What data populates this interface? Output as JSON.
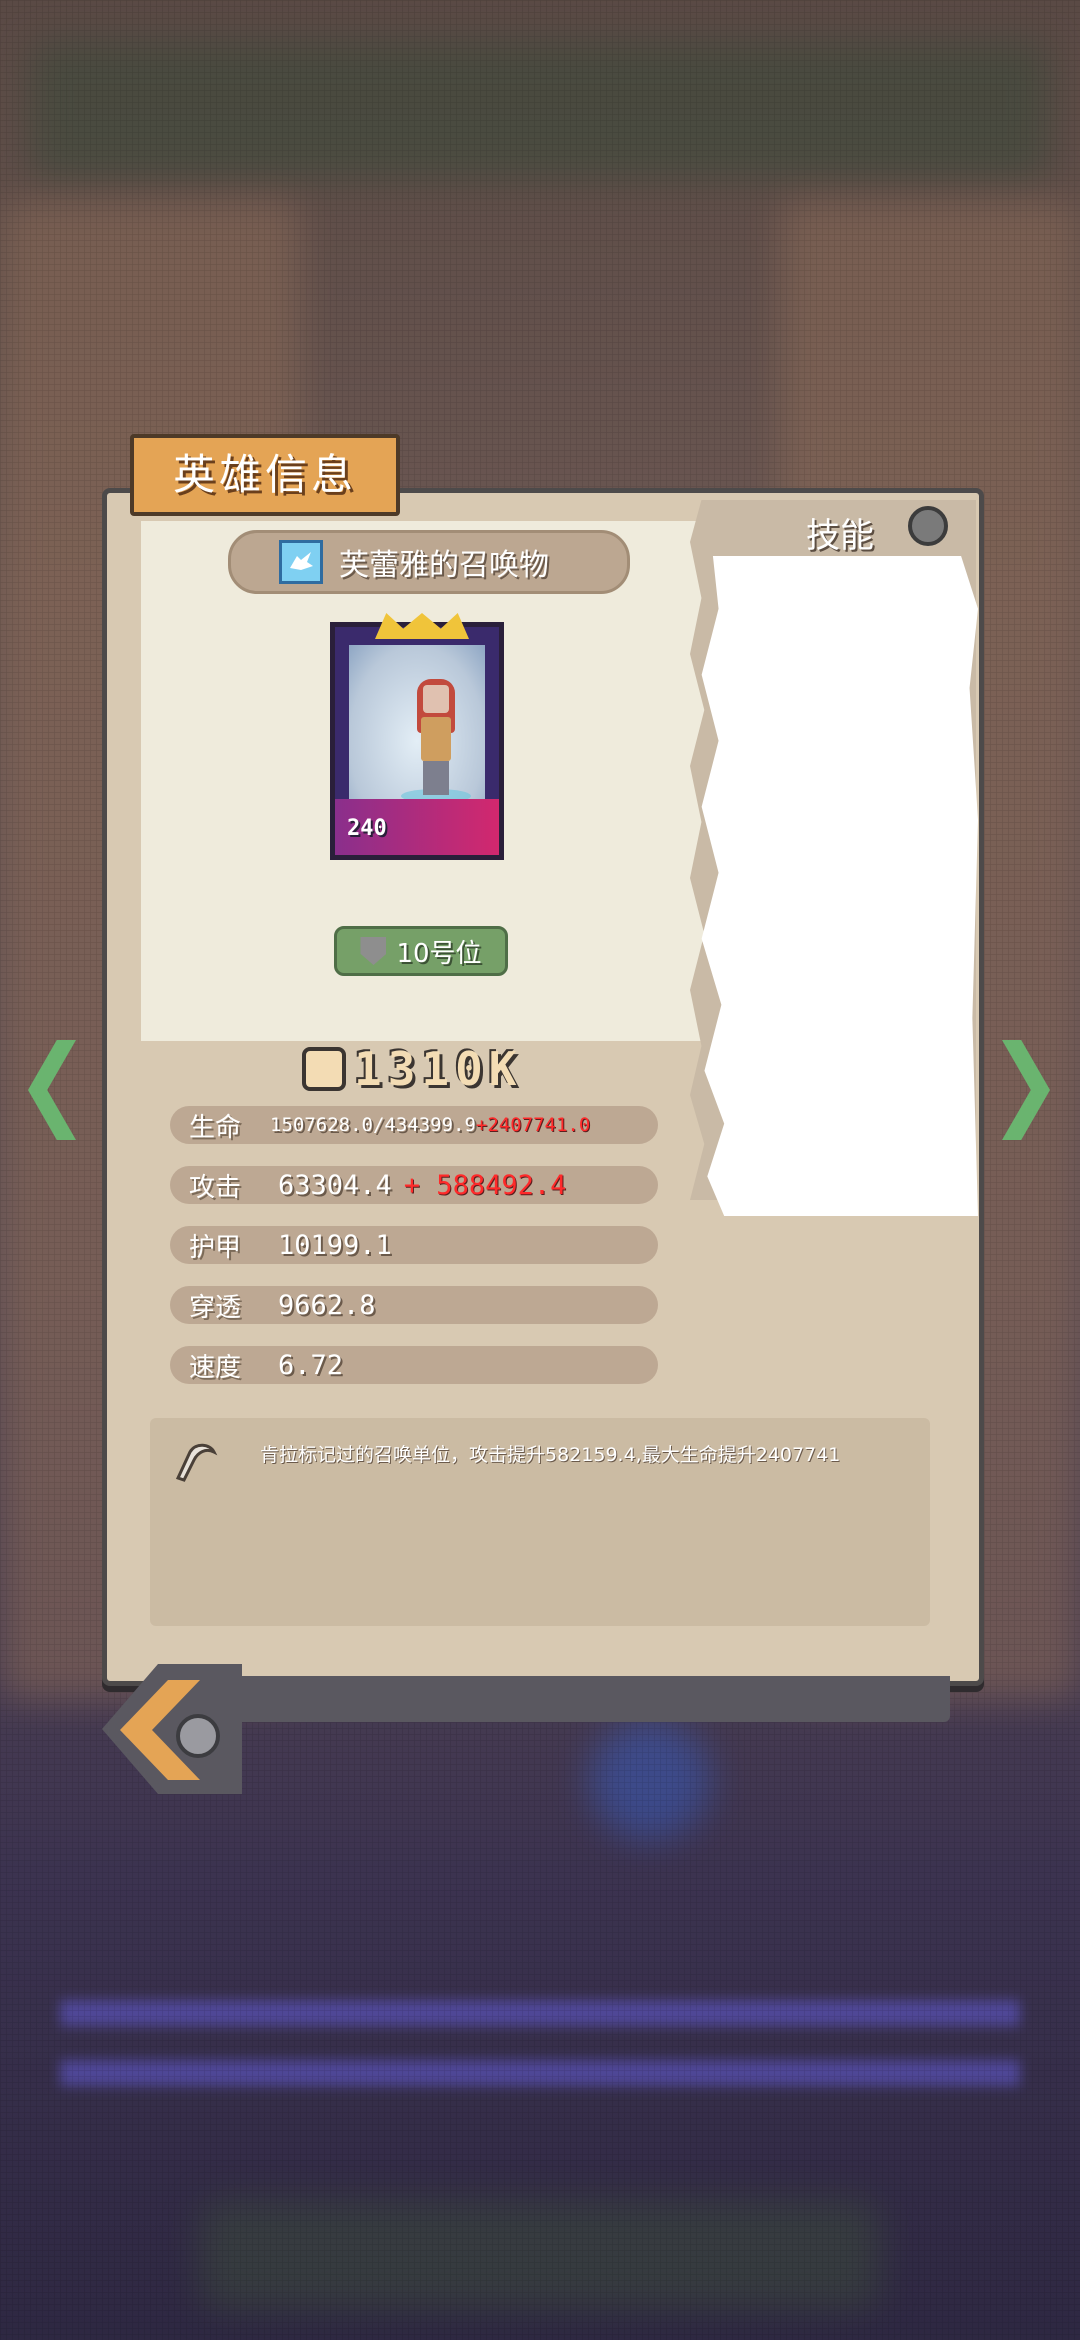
{
  "panel": {
    "title": "英雄信息",
    "skill_tab": "技能"
  },
  "hero": {
    "name": "芙蕾雅的召唤物",
    "level": "240",
    "slot": "10号位",
    "power": "1310K"
  },
  "stats": [
    {
      "label": "生命",
      "base": "1507628.0/434399.9",
      "bonus": "+2407741.0"
    },
    {
      "label": "攻击",
      "base": "63304.4",
      "bonus": "+ 588492.4"
    },
    {
      "label": "护甲",
      "base": "10199.1",
      "bonus": ""
    },
    {
      "label": "穿透",
      "base": "9662.8",
      "bonus": ""
    },
    {
      "label": "速度",
      "base": "6.72",
      "bonus": ""
    }
  ],
  "skill": {
    "description": "肯拉标记过的召唤单位，攻击提升582159.4,最大生命提升2407741"
  },
  "colors": {
    "accent_orange": "#e4a455",
    "bonus_red": "#ff2a2a",
    "slot_green": "#76a068",
    "nav_green": "#6ab46f"
  }
}
